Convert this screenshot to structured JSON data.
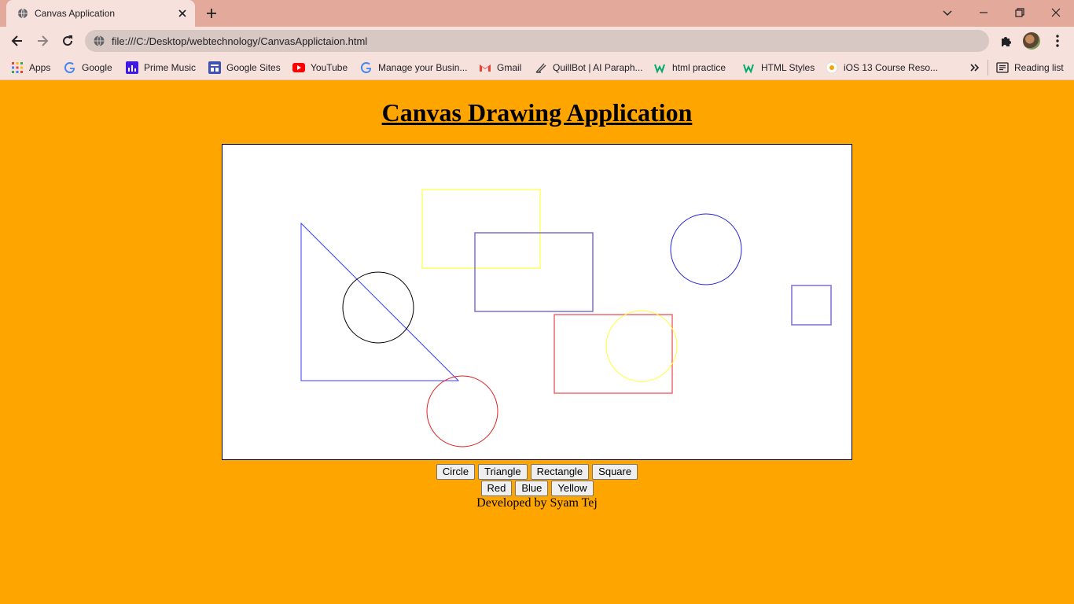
{
  "browser": {
    "tab_title": "Canvas Application",
    "url": "file:///C:/Desktop/webtechnology/CanvasApplictaion.html",
    "reading_list_label": "Reading list",
    "bookmarks": [
      {
        "label": "Apps",
        "icon": "apps-grid-icon"
      },
      {
        "label": "Google",
        "icon": "google-icon"
      },
      {
        "label": "Prime Music",
        "icon": "prime-music-icon"
      },
      {
        "label": "Google Sites",
        "icon": "google-sites-icon"
      },
      {
        "label": "YouTube",
        "icon": "youtube-icon"
      },
      {
        "label": "Manage your Busin...",
        "icon": "google-icon"
      },
      {
        "label": "Gmail",
        "icon": "gmail-icon"
      },
      {
        "label": "QuillBot | AI Paraph...",
        "icon": "quillbot-icon"
      },
      {
        "label": "html practice",
        "icon": "w3schools-icon"
      },
      {
        "label": "HTML Styles",
        "icon": "w3schools-icon"
      },
      {
        "label": "iOS 13 Course Reso...",
        "icon": "course-icon"
      }
    ]
  },
  "page": {
    "heading": "Canvas Drawing Application",
    "shape_buttons": [
      "Circle",
      "Triangle",
      "Rectangle",
      "Square"
    ],
    "color_buttons": [
      "Red",
      "Blue",
      "Yellow"
    ],
    "footer": "Developed by Syam Tej"
  },
  "colors": {
    "page_background": "#ffa500",
    "titlebar": "#e3a99b",
    "toolbar": "#f7e1dc",
    "canvas_background": "#ffffff"
  }
}
